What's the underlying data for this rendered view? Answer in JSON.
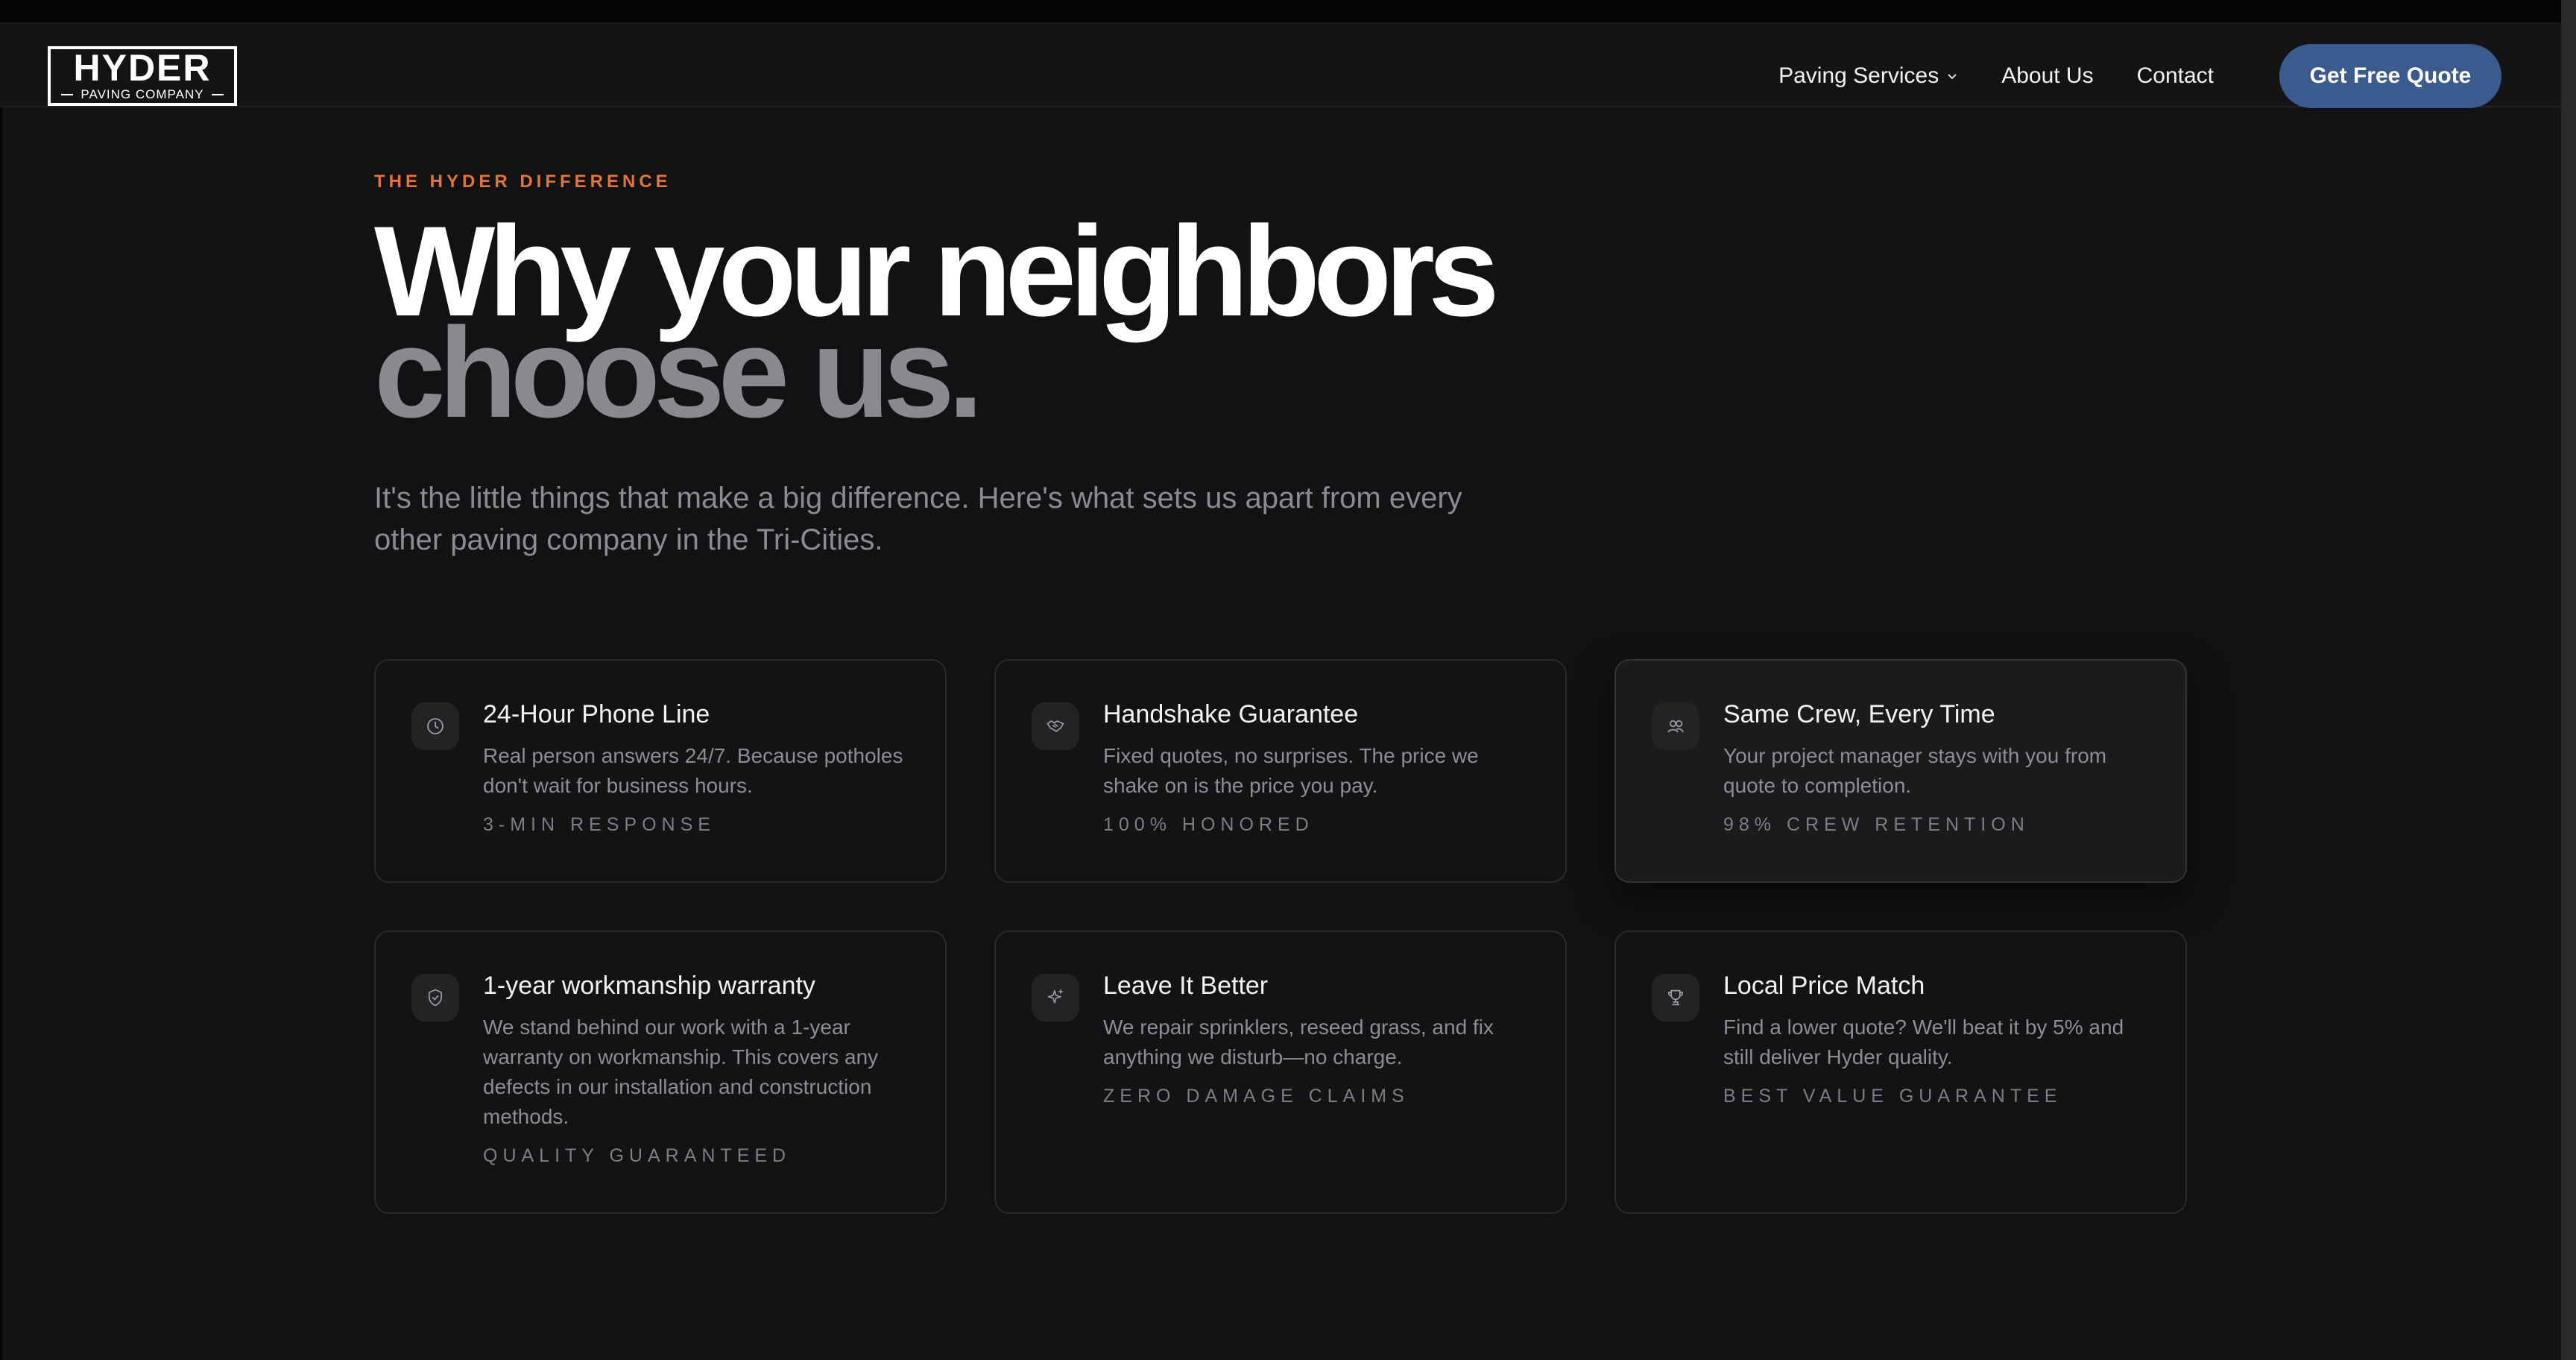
{
  "header": {
    "logo": {
      "word": "HYDER",
      "sub": "PAVING COMPANY"
    },
    "nav": [
      {
        "label": "Paving Services",
        "has_dropdown": true
      },
      {
        "label": "About Us",
        "has_dropdown": false
      },
      {
        "label": "Contact",
        "has_dropdown": false
      }
    ],
    "cta_label": "Get Free Quote"
  },
  "hero": {
    "eyebrow": "THE HYDER DIFFERENCE",
    "headline_line1": "Why your neighbors",
    "headline_line2": "choose us.",
    "lead": "It's the little things that make a big difference. Here's what sets us apart from every other paving company in the Tri-Cities."
  },
  "features": [
    {
      "icon": "clock-icon",
      "title": "24-Hour Phone Line",
      "desc": "Real person answers 24/7. Because potholes don't wait for business hours.",
      "metric": "3-MIN RESPONSE"
    },
    {
      "icon": "handshake-icon",
      "title": "Handshake Guarantee",
      "desc": "Fixed quotes, no surprises. The price we shake on is the price you pay.",
      "metric": "100% HONORED"
    },
    {
      "icon": "users-icon",
      "title": "Same Crew, Every Time",
      "desc": "Your project manager stays with you from quote to completion.",
      "metric": "98% CREW RETENTION"
    },
    {
      "icon": "shield-check-icon",
      "title": "1-year workmanship warranty",
      "desc": "We stand behind our work with a 1-year warranty on workmanship. This covers any defects in our installation and construction methods.",
      "metric": "QUALITY GUARANTEED"
    },
    {
      "icon": "sparkle-icon",
      "title": "Leave It Better",
      "desc": "We repair sprinklers, reseed grass, and fix anything we disturb—no charge.",
      "metric": "ZERO DAMAGE CLAIMS"
    },
    {
      "icon": "trophy-icon",
      "title": "Local Price Match",
      "desc": "Find a lower quote? We'll beat it by 5% and still deliver Hyder quality.",
      "metric": "BEST VALUE GUARANTEE"
    }
  ],
  "colors": {
    "background": "#121214",
    "accent_orange": "#e3733b",
    "cta_blue": "#3b5b8e",
    "muted_text": "#8b8b90"
  }
}
